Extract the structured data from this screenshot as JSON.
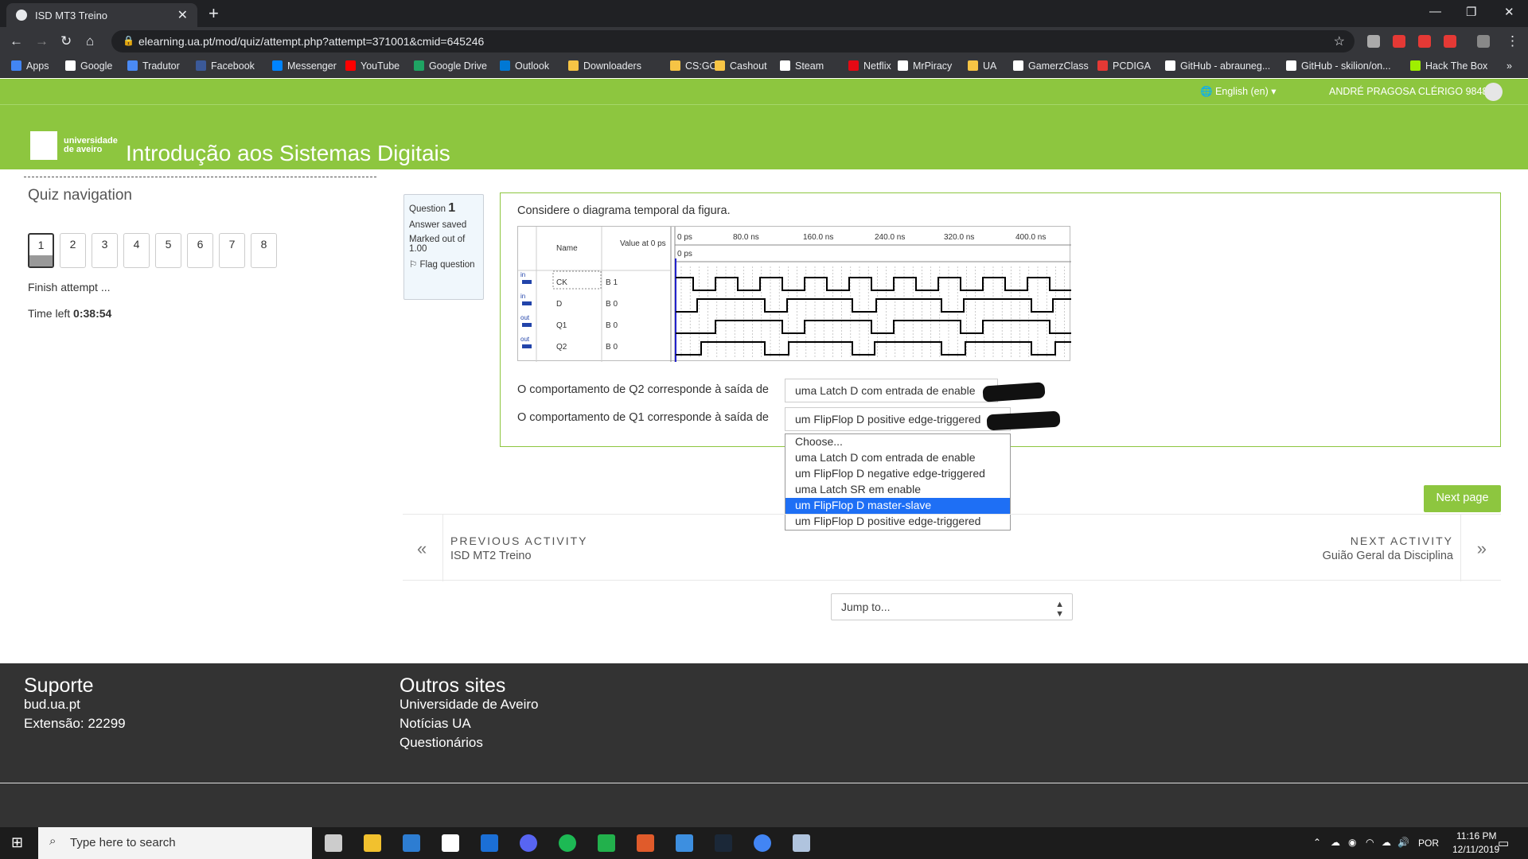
{
  "browser": {
    "tab_title": "ISD MT3 Treino",
    "tab_close": "✕",
    "new_tab": "+",
    "url": "elearning.ua.pt/mod/quiz/attempt.php?attempt=371001&cmid=645246",
    "bookmarks": [
      "Apps",
      "Google",
      "Tradutor",
      "Facebook",
      "Messenger",
      "YouTube",
      "Google Drive",
      "Outlook",
      "Downloaders",
      "CS:GO",
      "Cashout",
      "Steam",
      "Netflix",
      "MrPiracy",
      "UA",
      "GamerzClass",
      "PCDIGA",
      "GitHub - abrauneg...",
      "GitHub - skilion/on...",
      "Hack The Box"
    ],
    "bookmark_colors": [
      "#4285f4",
      "#ffffff",
      "#4a8af4",
      "#3b5998",
      "#0084ff",
      "#ff0000",
      "#1fa463",
      "#0078d4",
      "#f6c445",
      "#f6c445",
      "#f6c445",
      "#ffffff",
      "#e50914",
      "#ffffff",
      "#f6c445",
      "#ffffff",
      "#e53935",
      "#ffffff",
      "#ffffff",
      "#9fef00"
    ],
    "extension_colors": [
      "#aaaaaa",
      "#e53935",
      "#e53935",
      "#e53935",
      "#888888"
    ]
  },
  "moodle": {
    "language": "English (en) ▾",
    "user_name": "ANDRÉ PRAGOSA CLÉRIGO 98485",
    "logo_text_1": "universidade",
    "logo_text_2": "de aveiro",
    "course_title": "Introdução aos Sistemas Digitais"
  },
  "quiz_nav": {
    "title": "Quiz navigation",
    "questions": [
      "1",
      "2",
      "3",
      "4",
      "5",
      "6",
      "7",
      "8"
    ],
    "finish": "Finish attempt ...",
    "time_label": "Time left",
    "time_value": "0:38:54"
  },
  "question": {
    "label": "Question",
    "number": "1",
    "status": "Answer saved",
    "marked": "Marked out of 1.00",
    "flag": "Flag question",
    "text": "Considere o diagrama temporal da figura.",
    "diagram": {
      "col_name": "Name",
      "col_value": "Value at 0 ps",
      "time_labels": [
        "0 ps",
        "80.0 ns",
        "160.0 ns",
        "240.0 ns",
        "320.0 ns",
        "400.0 ns"
      ],
      "cursor_label": "0 ps",
      "signals": [
        {
          "dir": "in",
          "name": "CK",
          "value": "B 1"
        },
        {
          "dir": "in",
          "name": "D",
          "value": "B 0"
        },
        {
          "dir": "out",
          "name": "Q1",
          "value": "B 0"
        },
        {
          "dir": "out",
          "name": "Q2",
          "value": "B 0"
        }
      ]
    },
    "q2_text": "O comportamento de Q2 corresponde à saída de",
    "q2_answer": "uma Latch D com entrada de enable",
    "q1_text": "O comportamento de Q1 corresponde à saída de",
    "q1_answer": "um FlipFlop D positive edge-triggered",
    "options": [
      "Choose...",
      "uma Latch D com entrada de enable",
      "um FlipFlop D negative edge-triggered",
      "uma Latch SR em enable",
      "um FlipFlop D master-slave",
      "um FlipFlop D positive edge-triggered"
    ],
    "highlighted_option": 4
  },
  "next_page": "Next page",
  "activity_nav": {
    "prev_label": "PREVIOUS ACTIVITY",
    "prev_name": "ISD MT2 Treino",
    "next_label": "NEXT ACTIVITY",
    "next_name": "Guião Geral da Disciplina"
  },
  "jump_to": "Jump to...",
  "footer": {
    "support_title": "Suporte",
    "support_links": [
      "bud.ua.pt",
      "Extensão: 22299"
    ],
    "others_title": "Outros sites",
    "others_links": [
      "Universidade de Aveiro",
      "Notícias UA",
      "Questionários"
    ]
  },
  "taskbar": {
    "search_placeholder": "Type here to search",
    "language": "POR",
    "time": "11:16 PM",
    "date": "12/11/2019",
    "app_colors": [
      "#cccccc",
      "#f2c12e",
      "#2d7dd2",
      "#ffffff",
      "#1b6fd6",
      "#5865f2",
      "#1db954",
      "#22b14c",
      "#e05b2b",
      "#3d8fe0",
      "#1b2838",
      "#4285f4",
      "#b0c4de"
    ]
  },
  "colors": {
    "moodle_green": "#8dc63f",
    "footer_bg": "#333333",
    "selected_option": "#1e6ff5"
  }
}
